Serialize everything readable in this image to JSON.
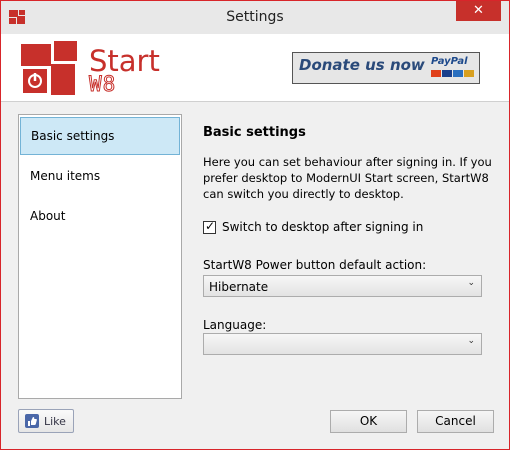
{
  "window": {
    "title": "Settings",
    "close_glyph": "✕"
  },
  "header": {
    "logo_text_1": "Start",
    "logo_text_2": "W8",
    "donate_label": "Donate us now",
    "paypal_label": "PayPal"
  },
  "sidebar": {
    "items": [
      {
        "label": "Basic settings",
        "selected": true
      },
      {
        "label": "Menu items",
        "selected": false
      },
      {
        "label": "About",
        "selected": false
      }
    ]
  },
  "content": {
    "title": "Basic settings",
    "description": "Here you can set behaviour after signing in. If you prefer desktop to ModernUI Start screen, StartW8 can switch you directly to desktop.",
    "switch_checkbox": {
      "label": "Switch to desktop after signing in",
      "checked": true,
      "glyph": "✓"
    },
    "power_label": "StartW8 Power button default action:",
    "power_value": "Hibernate",
    "language_label": "Language:",
    "language_value": "",
    "dropdown_glyph": "⌄"
  },
  "footer": {
    "like_label": "Like",
    "ok_label": "OK",
    "cancel_label": "Cancel"
  },
  "colors": {
    "accent_red": "#c7302b",
    "selection_bg": "#cde8f6",
    "selection_border": "#73b3d6"
  }
}
